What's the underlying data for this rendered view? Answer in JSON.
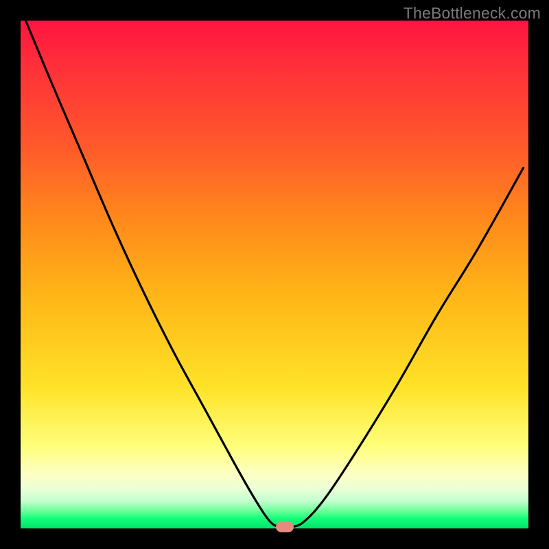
{
  "watermark": "TheBottleneck.com",
  "colors": {
    "frame": "#000000",
    "gradient_top": "#ff1440",
    "gradient_mid": "#ffe227",
    "gradient_bottom": "#00e46a",
    "curve": "#000000",
    "marker": "#e68a7f"
  },
  "chart_data": {
    "type": "line",
    "title": "",
    "xlabel": "",
    "ylabel": "",
    "xlim": [
      0,
      100
    ],
    "ylim": [
      0,
      100
    ],
    "grid": false,
    "series": [
      {
        "name": "bottleneck-curve",
        "x": [
          1,
          6,
          12,
          18,
          24,
          30,
          36,
          42,
          46,
          49,
          51,
          53.5,
          56,
          60,
          66,
          74,
          82,
          90,
          99
        ],
        "y": [
          100,
          88,
          74,
          60,
          47,
          35,
          24,
          13,
          6,
          1.5,
          0.3,
          0.3,
          1.5,
          6,
          15,
          28,
          42,
          55,
          71
        ]
      }
    ],
    "annotations": [
      {
        "name": "min-marker",
        "x": 52,
        "y": 0.3
      }
    ],
    "legend": false
  }
}
